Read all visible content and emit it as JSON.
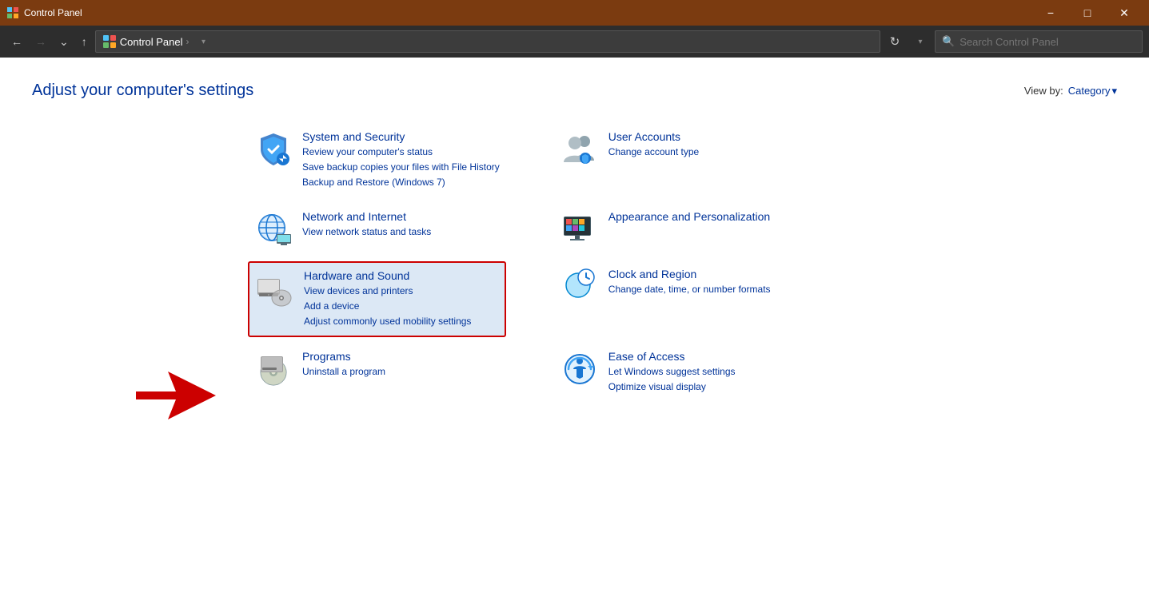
{
  "titlebar": {
    "title": "Control Panel",
    "minimize": "−",
    "maximize": "□",
    "close": "✕"
  },
  "navbar": {
    "back": "←",
    "forward": "→",
    "dropdown": "⌄",
    "up": "↑",
    "address_icon": "🖥",
    "breadcrumb1": "Control Panel",
    "sep": ">",
    "refresh": "↻",
    "dropdown_addr": "⌄",
    "search_placeholder": "Search Control Panel"
  },
  "page": {
    "title": "Adjust your computer's settings",
    "viewby_label": "View by:",
    "viewby_value": "Category",
    "viewby_arrow": "▾"
  },
  "categories": [
    {
      "id": "system-security",
      "name": "System and Security",
      "links": [
        "Review your computer's status",
        "Save backup copies your files with File History",
        "Backup and Restore (Windows 7)"
      ],
      "highlighted": false
    },
    {
      "id": "user-accounts",
      "name": "User Accounts",
      "links": [
        "Change account type"
      ],
      "highlighted": false
    },
    {
      "id": "network-internet",
      "name": "Network and Internet",
      "links": [
        "View network status and tasks"
      ],
      "highlighted": false
    },
    {
      "id": "appearance",
      "name": "Appearance and Personalization",
      "links": [],
      "highlighted": false
    },
    {
      "id": "hardware-sound",
      "name": "Hardware and Sound",
      "links": [
        "View devices and printers",
        "Add a device",
        "Adjust commonly used mobility settings"
      ],
      "highlighted": true
    },
    {
      "id": "clock-region",
      "name": "Clock and Region",
      "links": [
        "Change date, time, or number formats"
      ],
      "highlighted": false
    },
    {
      "id": "programs",
      "name": "Programs",
      "links": [
        "Uninstall a program"
      ],
      "highlighted": false
    },
    {
      "id": "ease-access",
      "name": "Ease of Access",
      "links": [
        "Let Windows suggest settings",
        "Optimize visual display"
      ],
      "highlighted": false
    }
  ]
}
